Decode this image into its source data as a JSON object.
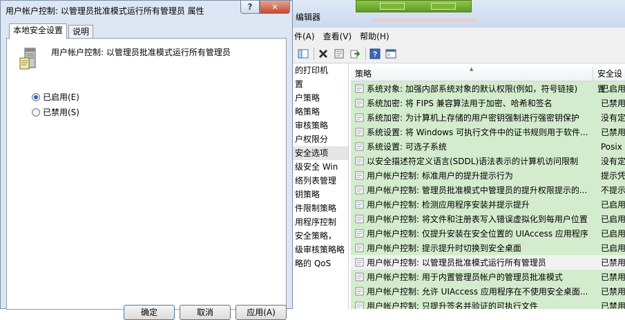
{
  "background_window": {
    "title": "编辑器",
    "menu": [
      "件(A)",
      "查看(V)",
      "帮助(H)"
    ],
    "tree_items": [
      "的打印机",
      "置",
      "户策略",
      "略策略",
      "审核策略",
      "户权限分",
      "安全选项",
      "级安全 Win",
      "络列表管理",
      "钥策略",
      "件限制策略",
      "用程序控制",
      "安全策略，",
      "级审核策略略",
      "略的 QoS"
    ],
    "tree_selected_index": 6,
    "columns": {
      "policy": "策略",
      "setting": "安全设置"
    },
    "rows": [
      {
        "policy": "系统对象: 加强内部系统对象的默认权限(例如，符号链接)",
        "setting": "已启用",
        "style": "green"
      },
      {
        "policy": "系统加密: 将 FIPS 兼容算法用于加密、哈希和签名",
        "setting": "已禁用",
        "style": "green"
      },
      {
        "policy": "系统加密: 为计算机上存储的用户密钥强制进行强密钥保护",
        "setting": "没有定义",
        "style": "green"
      },
      {
        "policy": "系统设置: 将 Windows 可执行文件中的证书规则用于软件...",
        "setting": "已禁用",
        "style": "green"
      },
      {
        "policy": "系统设置: 可选子系统",
        "setting": "Posix",
        "style": "green"
      },
      {
        "policy": "以安全描述符定义语言(SDDL)语法表示的计算机访问限制",
        "setting": "没有定义",
        "style": "green"
      },
      {
        "policy": "用户帐户控制: 标准用户的提升提示行为",
        "setting": "提示凭据",
        "style": "green"
      },
      {
        "policy": "用户帐户控制: 管理员批准模式中管理员的提升权限提示的...",
        "setting": "不提示",
        "style": "green"
      },
      {
        "policy": "用户帐户控制: 检测应用程序安装并提示提升",
        "setting": "已启用",
        "style": "green"
      },
      {
        "policy": "用户帐户控制: 将文件和注册表写入错误虚拟化到每用户位置",
        "setting": "已启用",
        "style": "green"
      },
      {
        "policy": "用户帐户控制: 仅提升安装在安全位置的 UIAccess 应用程序",
        "setting": "已启用",
        "style": "green"
      },
      {
        "policy": "用户帐户控制: 提示提升时切换到安全桌面",
        "setting": "已启用",
        "style": "green"
      },
      {
        "policy": "用户帐户控制: 以管理员批准模式运行所有管理员",
        "setting": "已禁用",
        "style": "selected"
      },
      {
        "policy": "用户帐户控制: 用于内置管理员帐户的管理员批准模式",
        "setting": "已禁用",
        "style": "green"
      },
      {
        "policy": "用户帐户控制: 允许 UIAccess 应用程序在不使用安全桌面...",
        "setting": "已禁用",
        "style": "green"
      },
      {
        "policy": "用户帐户控制: 只提升签名并验证的可执行文件",
        "setting": "已禁用",
        "style": "green"
      }
    ]
  },
  "dialog": {
    "title": "用户帐户控制: 以管理员批准模式运行所有管理员 属性",
    "help_glyph": "?",
    "close_glyph": "✕",
    "tabs": [
      "本地安全设置",
      "说明"
    ],
    "active_tab_index": 0,
    "policy_name": "用户帐户控制: 以管理员批准模式运行所有管理员",
    "options": [
      {
        "label": "已启用(E)",
        "checked": true
      },
      {
        "label": "已禁用(S)",
        "checked": false
      }
    ],
    "buttons": {
      "ok": "确定",
      "cancel": "取消",
      "apply": "应用(A)"
    }
  }
}
